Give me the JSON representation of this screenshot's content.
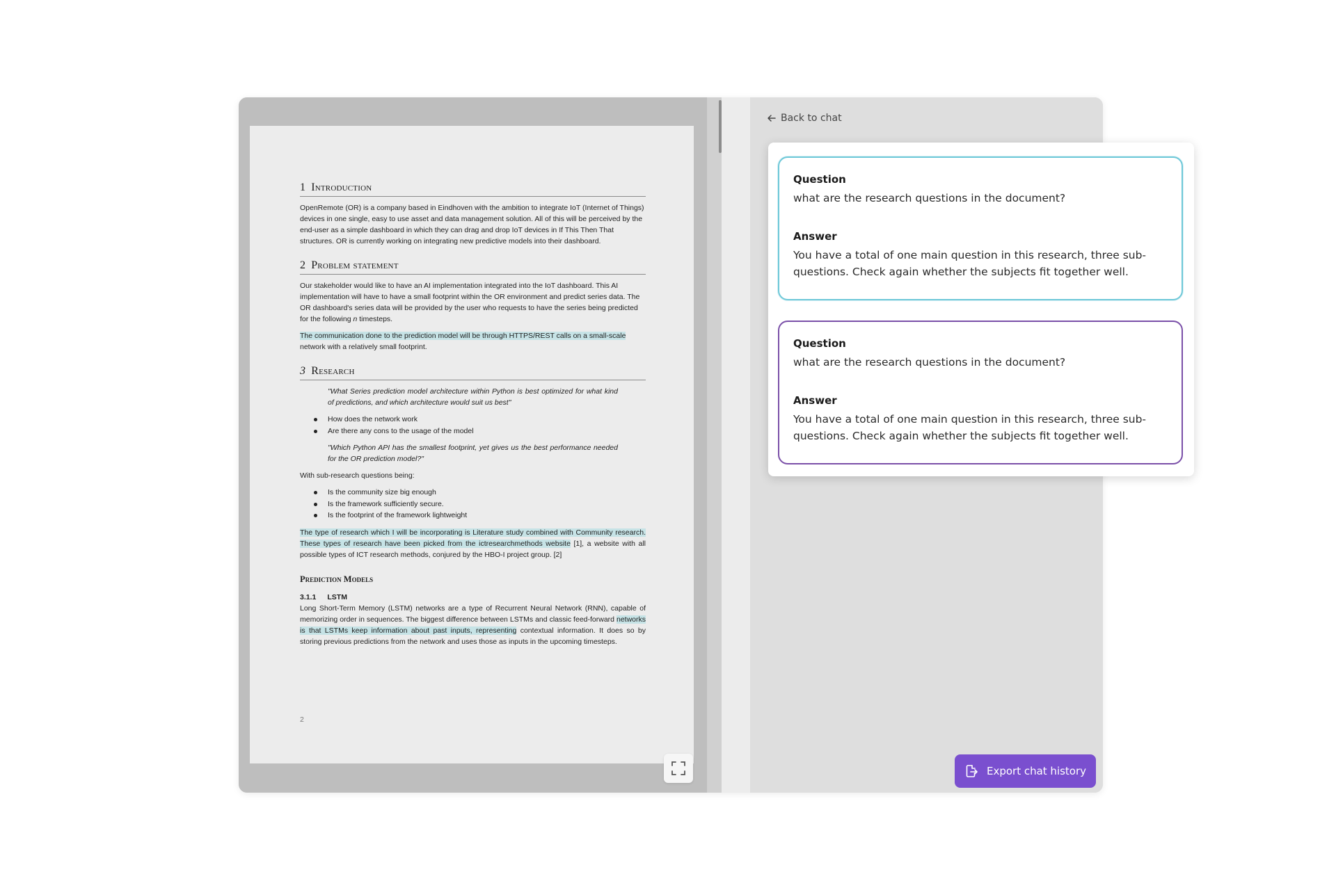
{
  "document": {
    "sections": [
      {
        "num": "1",
        "title": "Introduction",
        "body": "OpenRemote (OR) is a company based in Eindhoven with the ambition to integrate IoT (Internet of Things) devices in one single, easy to use asset and data management solution. All of this will be perceived by the end-user as a simple dashboard in which they can drag and drop IoT devices in If This Then That structures. OR is currently working on integrating new predictive models into their dashboard."
      },
      {
        "num": "2",
        "title": "Problem statement",
        "body_before": "Our stakeholder would like to have an AI implementation integrated into the IoT dashboard. This AI implementation will have to have a small footprint within the OR environment and predict series data. The OR dashboard's series data will be provided by the user who requests to have the series being predicted for the following ",
        "body_italic": "n",
        "body_after": " timesteps.",
        "highlight": "The communication done to the prediction model will be through HTTPS/REST calls on a small-scale",
        "body_tail": "network with a relatively small footprint."
      },
      {
        "num": "3",
        "title": "Research",
        "quote1": "\"What Series prediction model architecture within Python is best optimized for what kind of predictions, and which architecture would suit us best\"",
        "bullets1": [
          "How does the network work",
          "Are there any cons to the usage of the model"
        ],
        "quote2": "\"Which Python API has the smallest footprint, yet gives us the best performance needed for the OR prediction model?\"",
        "sub_intro": "With sub-research questions being:",
        "bullets2": [
          "Is the community size big enough",
          "Is the framework sufficiently secure.",
          "Is the footprint of the framework lightweight"
        ],
        "research_highlight": "The type of research which I will be incorporating is Literature study combined with Community research. These types of research have been picked from the ictresearchmethods website",
        "research_rest": " [1], a website with all possible types of ICT research methods, conjured by the HBO-I project group. [2]"
      }
    ],
    "prediction_heading": "Prediction Models",
    "lstm": {
      "num": "3.1.1",
      "title": "LSTM",
      "body_before": "Long Short-Term Memory (LSTM) networks are a type of Recurrent Neural Network (RNN), capable of memorizing order in sequences. The biggest difference between LSTMs and classic feed-forward ",
      "highlight": "networks is that LSTMs keep information about past inputs, representing",
      "body_after": " contextual information. It does so by storing previous predictions from the network and uses those as inputs in the upcoming timesteps."
    },
    "page_number": "2"
  },
  "chat": {
    "back_label": "Back to chat",
    "export_label": "Export chat history",
    "cards": [
      {
        "question_label": "Question",
        "question": "what are the research questions in the document?",
        "answer_label": "Answer",
        "answer": "You have a total of one main question in this research, three sub-questions. Check again whether the subjects fit together well."
      },
      {
        "question_label": "Question",
        "question": "what are the research questions in the document?",
        "answer_label": "Answer",
        "answer": "You have a total of one main question in this research, three sub-questions. Check again whether the subjects fit together well."
      }
    ]
  },
  "colors": {
    "accent": "#7a4fcf",
    "card_teal_border": "#6ec8d8",
    "card_purple_border": "#7a4fa8",
    "highlight": "#c6e3e6"
  },
  "icons": {
    "back": "arrow-left-icon",
    "export": "export-icon",
    "expand": "expand-icon"
  }
}
